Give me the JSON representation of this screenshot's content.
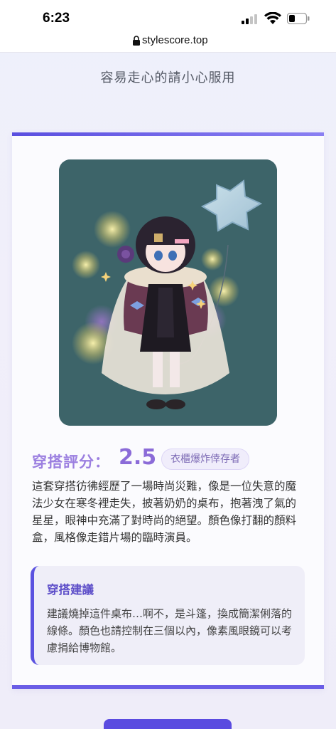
{
  "status_bar": {
    "time": "6:23",
    "icons": [
      "signal-icon",
      "wifi-icon",
      "battery-icon"
    ]
  },
  "browser": {
    "url": "stylescore.top",
    "lock_icon": "lock-icon"
  },
  "header": {
    "subtitle": "容易走心的請小心服用"
  },
  "card": {
    "image_alt_icon": "outfit-illustration",
    "score_label": "穿搭評分：",
    "score_value": "2.5",
    "score_badge": "衣櫃爆炸倖存者",
    "review_text": "這套穿搭彷彿經歷了一場時尚災難，像是一位失意的魔法少女在寒冬裡走失，披著奶奶的桌布，抱著洩了氣的星星，眼神中充滿了對時尚的絕望。顏色像打翻的顏料盒，風格像走錯片場的臨時演員。",
    "advice_title": "穿搭建議",
    "advice_text": "建議燒掉這件桌布…啊不，是斗篷，換成簡潔俐落的線條。顏色也請控制在三個以內，像素風眼鏡可以考慮捐給博物館。"
  },
  "colors": {
    "accent": "#6a5de6",
    "score_color": "#8b6bd8",
    "illustration_bg": "#3d6469"
  }
}
